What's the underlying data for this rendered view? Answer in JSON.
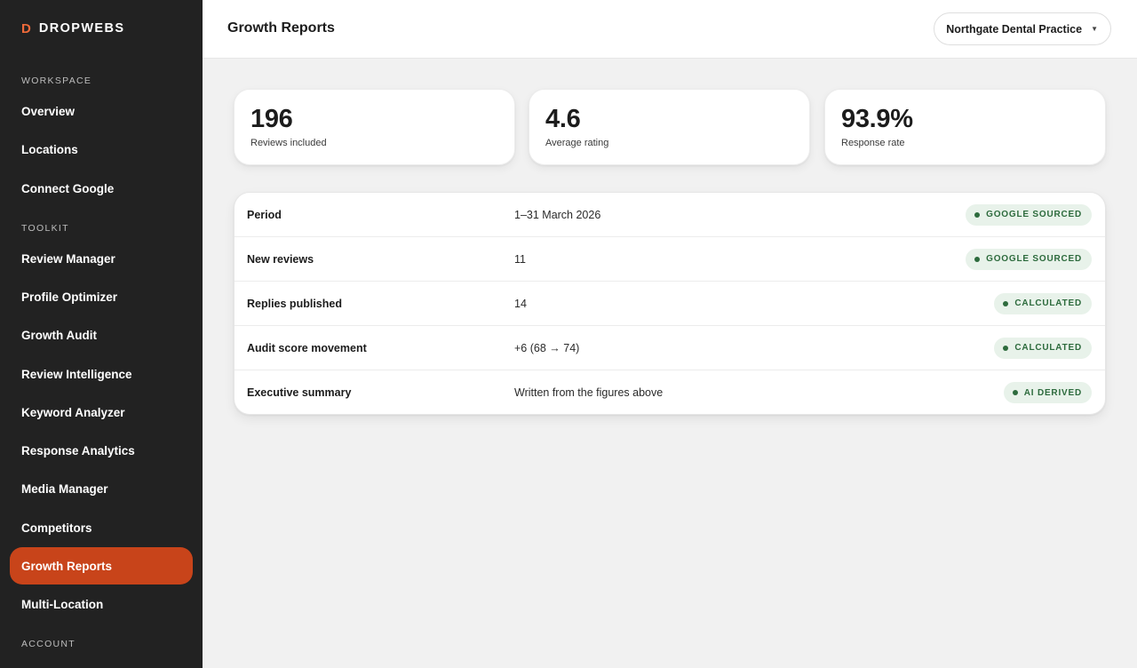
{
  "brand": {
    "mark": "D",
    "name": "DROPWEBS"
  },
  "sidebar": {
    "sections": {
      "workspace": "WORKSPACE",
      "toolkit": "TOOLKIT",
      "account": "ACCOUNT"
    },
    "workspace_items": [
      {
        "label": "Overview"
      },
      {
        "label": "Locations"
      },
      {
        "label": "Connect Google"
      }
    ],
    "toolkit_items": [
      {
        "label": "Review Manager"
      },
      {
        "label": "Profile Optimizer"
      },
      {
        "label": "Growth Audit"
      },
      {
        "label": "Review Intelligence"
      },
      {
        "label": "Keyword Analyzer"
      },
      {
        "label": "Response Analytics"
      },
      {
        "label": "Media Manager"
      },
      {
        "label": "Competitors"
      },
      {
        "label": "Growth Reports",
        "active": true
      },
      {
        "label": "Multi-Location"
      }
    ]
  },
  "header": {
    "title": "Growth Reports",
    "location_select": {
      "value": "Northgate Dental Practice",
      "icon": "chevron-down-icon"
    }
  },
  "stats": [
    {
      "value": "196",
      "label": "Reviews included"
    },
    {
      "value": "4.6",
      "label": "Average rating"
    },
    {
      "value": "93.9%",
      "label": "Response rate"
    }
  ],
  "report_rows": [
    {
      "label": "Period",
      "value": "1–31 March 2026",
      "badge": "GOOGLE SOURCED"
    },
    {
      "label": "New reviews",
      "value": "11",
      "badge": "GOOGLE SOURCED"
    },
    {
      "label": "Replies published",
      "value": "14",
      "badge": "CALCULATED"
    },
    {
      "label": "Audit score movement",
      "value": "+6 (68 → 74)",
      "badge": "CALCULATED"
    },
    {
      "label": "Executive summary",
      "value": "Written from the figures above",
      "badge": "AI DERIVED"
    }
  ],
  "colors": {
    "sidebar_bg": "#222222",
    "accent": "#c8441a",
    "brand_mark": "#ef6a3a",
    "badge_bg": "#e8f2ea",
    "badge_text": "#2d6b3d",
    "page_bg": "#f1f1f1"
  }
}
